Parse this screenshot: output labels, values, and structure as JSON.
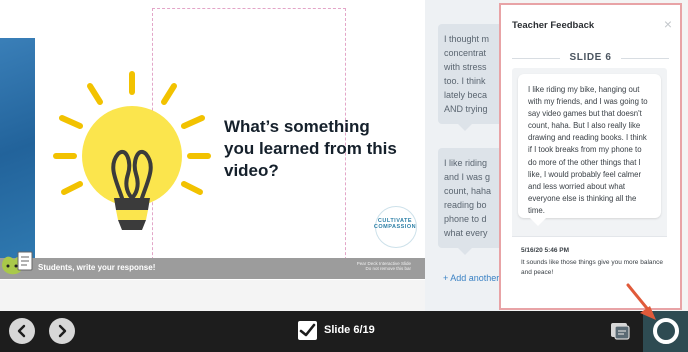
{
  "slide": {
    "question": "What’s something you learned from this video?",
    "footer_prompt": "Students, write your response!",
    "footer_meta_line1": "Pear Deck Interactive Slide",
    "footer_meta_line2": "Do not remove this bar",
    "badge_text": "CULTIVATE COMPASSION",
    "ghost_lines": [
      "",
      "",
      ""
    ]
  },
  "responses": {
    "card1_lines": [
      "I thought m",
      "concentrat",
      "with stress",
      "too.  I think",
      "lately beca",
      "AND trying"
    ],
    "card2_lines": [
      "I like riding",
      "and I was g",
      "count, haha",
      "reading bo",
      "phone to d",
      "what every"
    ],
    "add_link": "+ Add another r"
  },
  "panel": {
    "title": "Teacher Feedback",
    "close_icon": "×",
    "slide_label": "SLIDE 6",
    "student_response_lines": [
      "I like riding my bike, hanging out",
      "with my friends, and I was going to",
      "say video games but that doesn't",
      "count, haha. But I also really like",
      "drawing and reading books. I think",
      "if I took breaks from my phone to",
      "do more of the other things that I",
      "like, I would probably feel calmer",
      "and less worried about what",
      "everyone else is thinking all the",
      "time."
    ],
    "feedback_date": "5/16/20 5:46 PM",
    "feedback_lines": [
      "It sounds like those things give you more balance",
      "and peace!"
    ]
  },
  "toolbar": {
    "slide_counter": "Slide 6/19"
  },
  "colors": {
    "panel_border": "#e8a3a6",
    "toolbar_bg": "#1d1d1d",
    "active_button_bg": "#2e4b52",
    "accent_link": "#3b82c4",
    "arrow": "#e05a3a"
  }
}
